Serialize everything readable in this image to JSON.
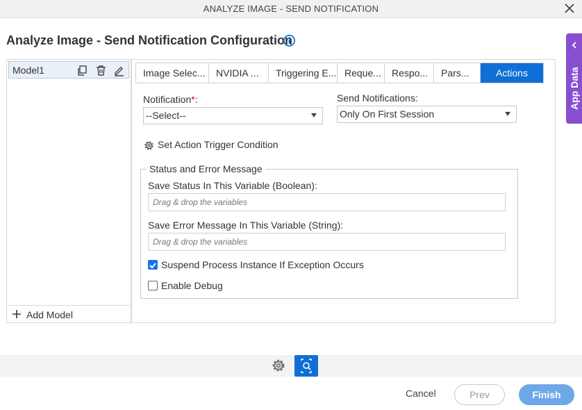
{
  "window": {
    "title": "ANALYZE IMAGE - SEND NOTIFICATION"
  },
  "header": {
    "title": "Analyze Image - Send Notification Configuration"
  },
  "models": {
    "items": [
      {
        "label": "Model1"
      }
    ],
    "add_label": "Add Model"
  },
  "tabs": [
    {
      "label": "Image Selec...",
      "active": false
    },
    {
      "label": "NVIDIA ...",
      "active": false
    },
    {
      "label": "Triggering E...",
      "active": false
    },
    {
      "label": "Reque...",
      "active": false
    },
    {
      "label": "Respo...",
      "active": false
    },
    {
      "label": "Pars...",
      "active": false
    },
    {
      "label": "Actions",
      "active": true
    }
  ],
  "form": {
    "notification": {
      "label": "Notification",
      "required_mark": "*",
      "colon": ":",
      "value": "--Select--"
    },
    "send_notifications": {
      "label": "Send Notifications:",
      "value": "Only On First Session"
    },
    "trigger_condition": "Set Action Trigger Condition",
    "status_group": {
      "legend": "Status and Error Message",
      "status_label": "Save Status In This Variable (Boolean):",
      "status_placeholder": "Drag & drop the variables",
      "error_label": "Save Error Message In This Variable (String):",
      "error_placeholder": "Drag & drop the variables",
      "suspend": {
        "label": "Suspend Process Instance If Exception Occurs",
        "checked": true
      },
      "debug": {
        "label": "Enable Debug",
        "checked": false
      }
    }
  },
  "footer": {
    "cancel": "Cancel",
    "prev": "Prev",
    "finish": "Finish"
  },
  "side_tab": {
    "label": "App Data"
  },
  "colors": {
    "accent": "#0f6fd6",
    "side_tab": "#8a4fd1",
    "finish": "#6ea8e6",
    "required": "#d0021b"
  }
}
